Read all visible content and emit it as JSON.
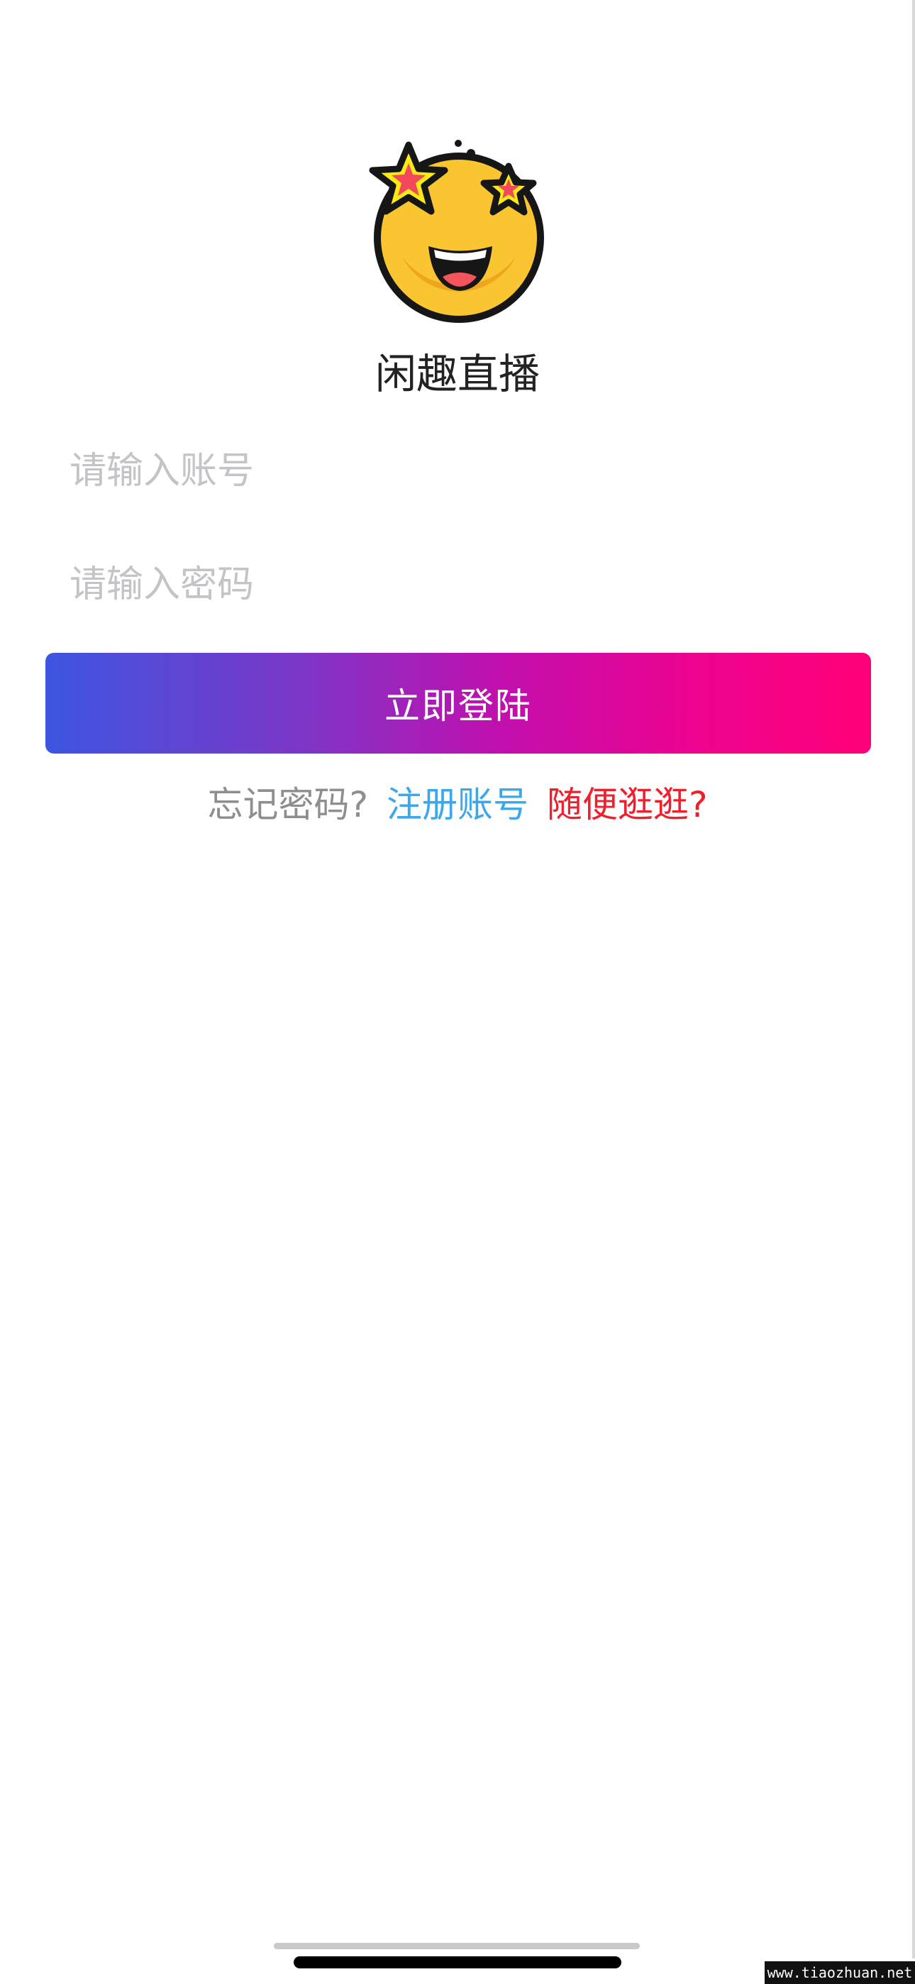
{
  "app": {
    "title": "闲趣直播"
  },
  "login_form": {
    "account_placeholder": "请输入账号",
    "account_value": "",
    "password_placeholder": "请输入密码",
    "password_value": "",
    "login_button": "立即登陆"
  },
  "links": {
    "forgot_password": "忘记密码?",
    "register": "注册账号",
    "browse": "随便逛逛?"
  },
  "icons": {
    "logo": "star-struck-emoji-icon"
  },
  "colors": {
    "gradient_start": "#3d55e0",
    "gradient_end": "#ff0077",
    "register_link": "#3aa8ea",
    "browse_link": "#ef1f2c",
    "forgot_link": "#8e8e8e",
    "placeholder": "#c2c4c8"
  },
  "watermark": "www.tiaozhuan.net"
}
